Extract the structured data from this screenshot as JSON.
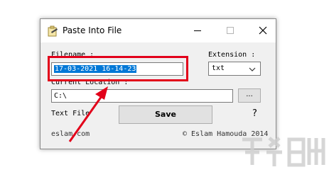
{
  "window": {
    "title": "Paste Into File",
    "controls": [
      "minimize-icon",
      "maximize-icon",
      "close-icon"
    ]
  },
  "form": {
    "filename_label": "Filename :",
    "filename_value": "17-03-2021 16-14-23",
    "extension_label": "Extension :",
    "extension_value": "txt",
    "location_label": "Current Location :",
    "location_value": "C:\\",
    "browse_label": "...",
    "text_file_label": "Text File",
    "save_label": "Save",
    "help_label": "?"
  },
  "footer": {
    "site": "eslam.com",
    "copyright": "© Eslam Hamouda 2014"
  },
  "annotation": {
    "highlight_color": "#e2001a",
    "arrow_color": "#e2001a"
  },
  "colors": {
    "selection": "#0078d7",
    "button_face": "#e1e1e1",
    "window_face": "#f0f0f0"
  }
}
